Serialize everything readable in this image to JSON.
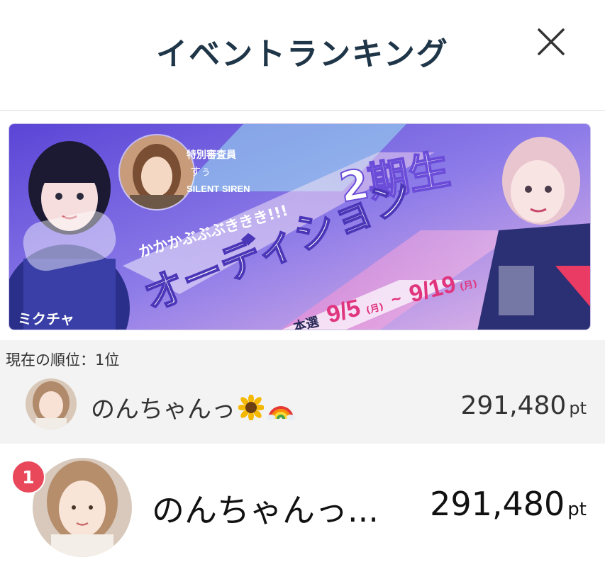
{
  "header": {
    "title": "イベントランキング",
    "close_icon": "close-icon"
  },
  "banner": {
    "brand": "ミクチャ",
    "judge_label": "特別審査員",
    "judge_name": "すぅ",
    "judge_group": "SILENT SIREN",
    "catch": "かかかぶぶぶききき!!!",
    "generation": "2期生",
    "audition": "オーディション",
    "final_label": "本選",
    "date_start": "9/5",
    "date_start_day": "(月)",
    "date_tilde": "~",
    "date_end": "9/19",
    "date_end_day": "(月)"
  },
  "current": {
    "label": "現在の順位：1位",
    "name": "のんちゃんっ",
    "emoji_icons": [
      "sunflower-icon",
      "rainbow-icon"
    ],
    "points": "291,480",
    "points_unit": "pt"
  },
  "ranking": [
    {
      "rank": "1",
      "name": "のんちゃんっ...",
      "points": "291,480",
      "points_unit": "pt"
    }
  ],
  "colors": {
    "title": "#1f3548",
    "badge": "#e8485a",
    "current_bg": "#f3f3f3",
    "banner_purple": "#6a4cd8"
  }
}
